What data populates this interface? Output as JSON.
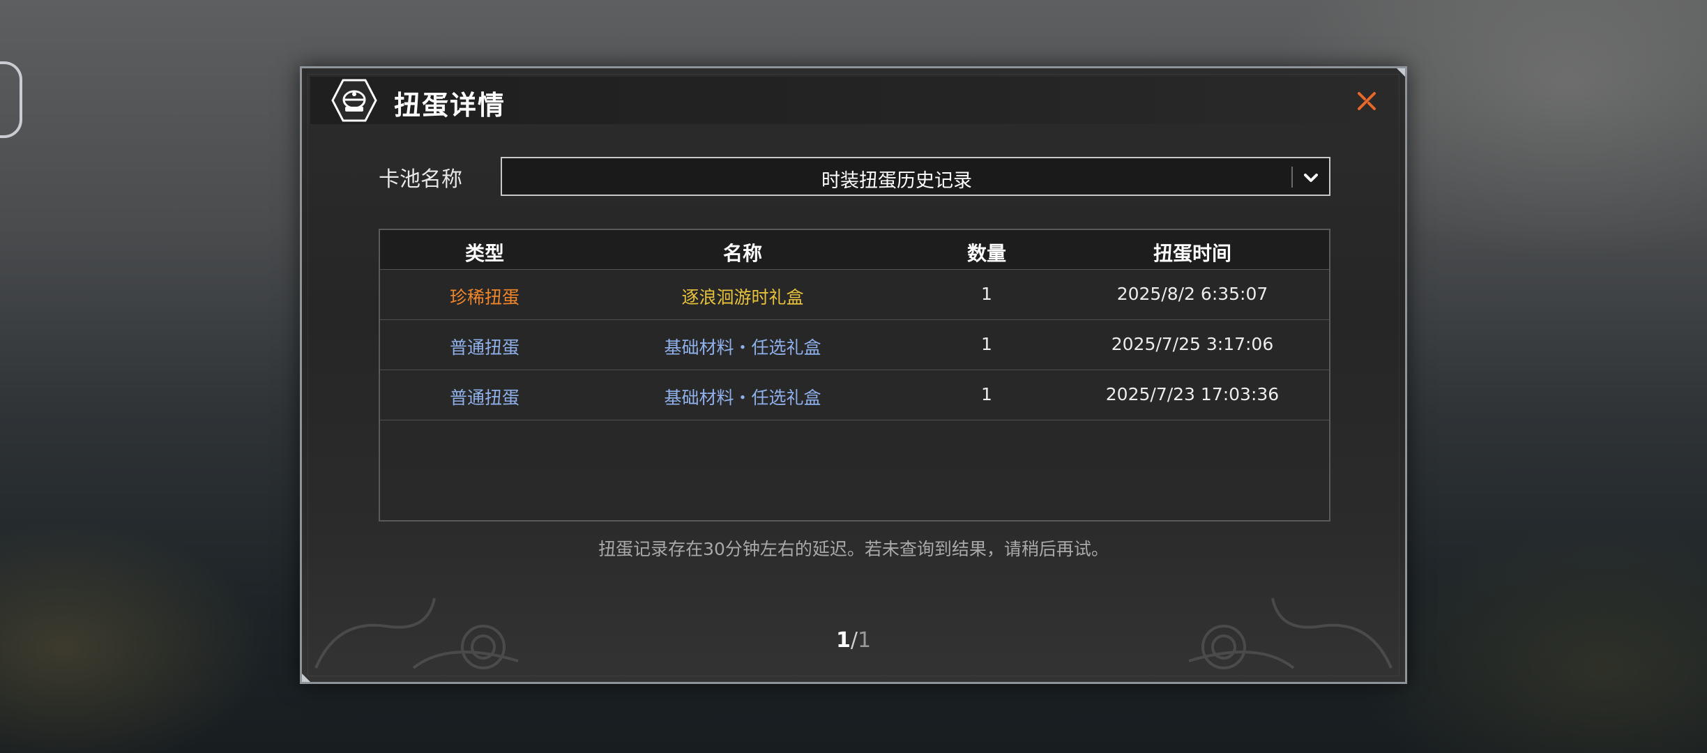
{
  "dialog": {
    "title": "扭蛋详情",
    "title_icon": "gacha-capsule-icon",
    "close_icon": "close-icon"
  },
  "pool": {
    "label": "卡池名称",
    "selected": "时装扭蛋历史记录",
    "dropdown_icon": "chevron-down-icon"
  },
  "table": {
    "headers": [
      "类型",
      "名称",
      "数量",
      "扭蛋时间"
    ],
    "rows": [
      {
        "type": "珍稀扭蛋",
        "name": "逐浪洄游时礼盒",
        "qty": "1",
        "time": "2025/8/2 6:35:07",
        "type_color": "#f0862a",
        "name_color": "#e7c23a"
      },
      {
        "type": "普通扭蛋",
        "name": "基础材料・任选礼盒",
        "qty": "1",
        "time": "2025/7/25 3:17:06",
        "type_color": "#8fb0ea",
        "name_color": "#8fb0ea"
      },
      {
        "type": "普通扭蛋",
        "name": "基础材料・任选礼盒",
        "qty": "1",
        "time": "2025/7/23 17:03:36",
        "type_color": "#8fb0ea",
        "name_color": "#8fb0ea"
      }
    ]
  },
  "notice": "扭蛋记录存在30分钟左右的延迟。若未查询到结果，请稍后再试。",
  "pager": {
    "current": "1",
    "separator": "/",
    "total": "1"
  },
  "colors": {
    "accent_close": "#e8682a",
    "border": "#8d949a"
  }
}
